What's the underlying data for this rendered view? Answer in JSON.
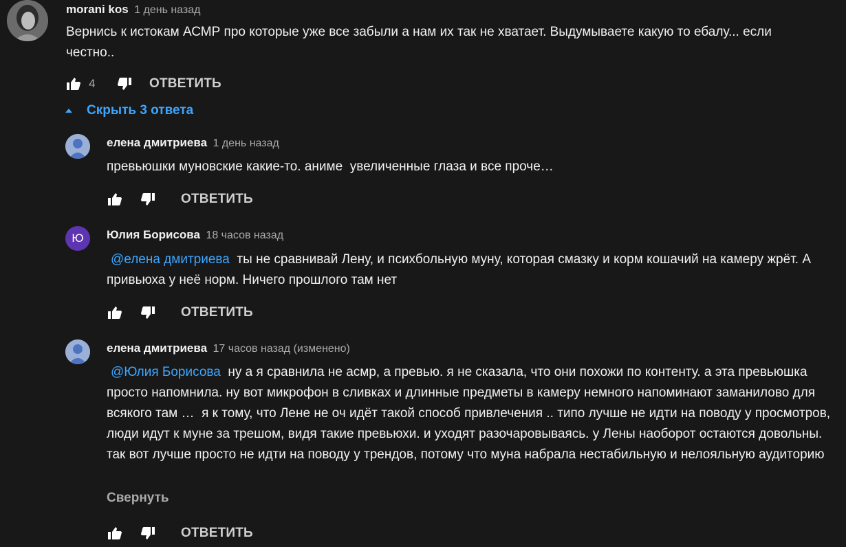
{
  "comment": {
    "author": "morani kos",
    "time": "1 день назад",
    "text": "Вернись к истокам АСМР про которые уже все забыли а нам их так не хватает. Выдумываете какую то ебалу... если честно..",
    "likes": "4",
    "reply_label": "ОТВЕТИТЬ"
  },
  "replies_toggle": {
    "label": "Скрыть 3 ответа"
  },
  "replies": [
    {
      "author": "елена дмитриева",
      "time": "1 день назад",
      "mention": "",
      "text": "превьюшки муновские какие-то. аниме  увеличенные глаза и все проче…",
      "reply_label": "ОТВЕТИТЬ",
      "avatar_letter": ""
    },
    {
      "author": "Юлия Борисова",
      "time": "18 часов назад",
      "mention": "@елена дмитриева",
      "text": "  ты не сравнивай Лену, и психбольную муну, которая смазку и корм кошачий на камеру жрёт. А привьюха у неё норм. Ничего прошлого там нет",
      "reply_label": "ОТВЕТИТЬ",
      "avatar_letter": "Ю"
    },
    {
      "author": "елена дмитриева",
      "time": "17 часов назад (изменено)",
      "mention": "@Юлия Борисова",
      "text": "  ну а я сравнила не асмр, а превью. я не сказала, что они похожи по контенту. а эта превьюшка просто напомнила. ну вот микрофон в сливках и длинные предметы в камеру немного напоминают заманилово для всякого там …  я к тому, что Лене не оч идёт такой способ привлечения .. типо лучше не идти на поводу у просмотров, люди идут к муне за трешом, видя такие превьюхи. и уходят разочаровываясь. у Лены наоборот остаются довольны. так вот лучше просто не идти на поводу у трендов, потому что муна набрала нестабильную и нелояльную аудиторию",
      "collapse_label": "Свернуть",
      "reply_label": "ОТВЕТИТЬ",
      "avatar_letter": ""
    }
  ],
  "colors": {
    "background": "#181818",
    "text": "#f1f1f1",
    "secondary": "#aaaaaa",
    "link": "#3ea6ff",
    "avatar_purple": "#5e35b1",
    "avatar_default": "#9bb0d6"
  },
  "icons": [
    "like-icon",
    "dislike-icon",
    "caret-up-icon",
    "default-avatar-icon"
  ]
}
